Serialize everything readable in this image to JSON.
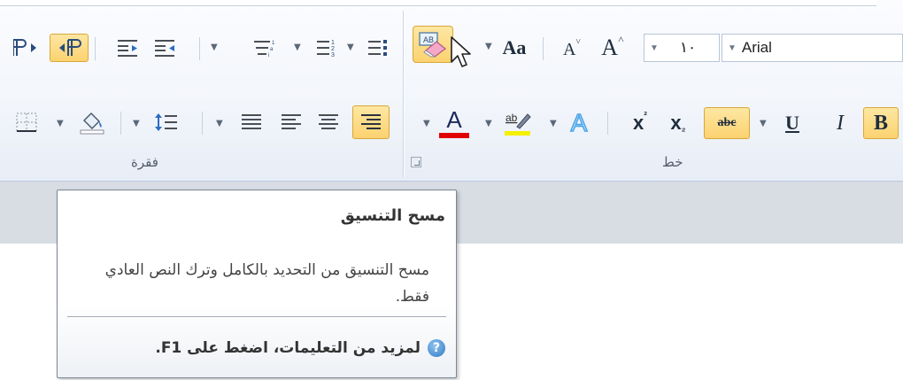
{
  "ribbon": {
    "groups": {
      "font_label": "خط",
      "paragraph_label": "فقرة"
    },
    "font_name": "Arial",
    "font_size": "١٠",
    "buttons": {
      "bold": "B",
      "italic": "I",
      "underline": "U",
      "strikethrough": "abc",
      "subscript": "x",
      "superscript": "x",
      "font_color": "A",
      "text_effects": "A",
      "change_case": "Aa",
      "grow_font": "A",
      "shrink_font": "A",
      "clear_formatting": "AB"
    }
  },
  "tooltip": {
    "title": "مسح التنسيق",
    "description": "مسح التنسيق من التحديد بالكامل وترك النص العادي فقط.",
    "help_text": "لمزيد من التعليمات، اضغط على F1.",
    "help_icon": "?"
  },
  "colors": {
    "active_fill": "#fcd270",
    "font_color_bar": "#e00000",
    "highlight_bar": "#f5f000",
    "help_blue": "#2f79c4"
  }
}
